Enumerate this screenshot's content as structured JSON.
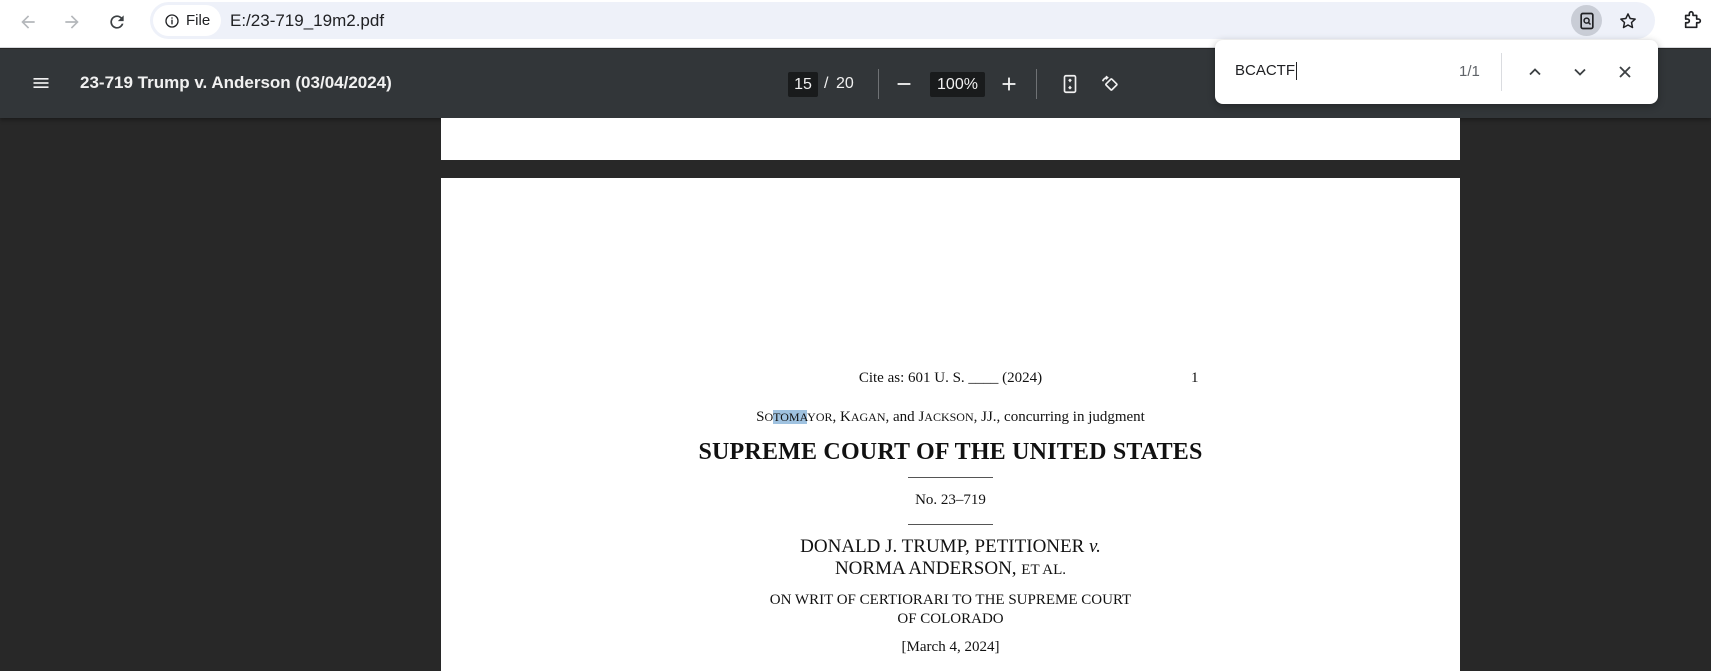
{
  "browser": {
    "site_chip_label": "File",
    "url": "E:/23-719_19m2.pdf",
    "icons": [
      "back-arrow-icon",
      "forward-arrow-icon",
      "reload-icon",
      "info-icon",
      "find-in-page-icon",
      "star-icon",
      "extensions-icon"
    ]
  },
  "pdf": {
    "title": "23-719 Trump v. Anderson (03/04/2024)",
    "current_page": "15",
    "page_separator": "/",
    "total_pages": "20",
    "zoom": "100%"
  },
  "find": {
    "query": "BCACTF",
    "count": "1/1"
  },
  "document": {
    "cite_line": "Cite as:  601 U. S. ____ (2024)",
    "page_number": "1",
    "concur": {
      "so": "S",
      "o": "O",
      "tomaa": "TOMA",
      "yor": "YOR",
      "comma1": ", ",
      "k": "K",
      "agan": "AGAN",
      "and": ", and ",
      "j": "J",
      "ackson": "ACKSON",
      "rest": ", JJ., concurring in judgment"
    },
    "court_title": "SUPREME COURT OF THE UNITED STATES",
    "docket": "No. 23–719",
    "party_line1_main": "DONALD J. TRUMP, PETITIONER ",
    "party_line1_v": "v.",
    "party_line2_main": "NORMA ANDERSON, ",
    "party_line2_etal": "ET AL.",
    "writ_line1": "ON WRIT OF CERTIORARI TO THE SUPREME COURT",
    "writ_line2": "OF COLORADO",
    "date": "[March 4, 2024]"
  }
}
